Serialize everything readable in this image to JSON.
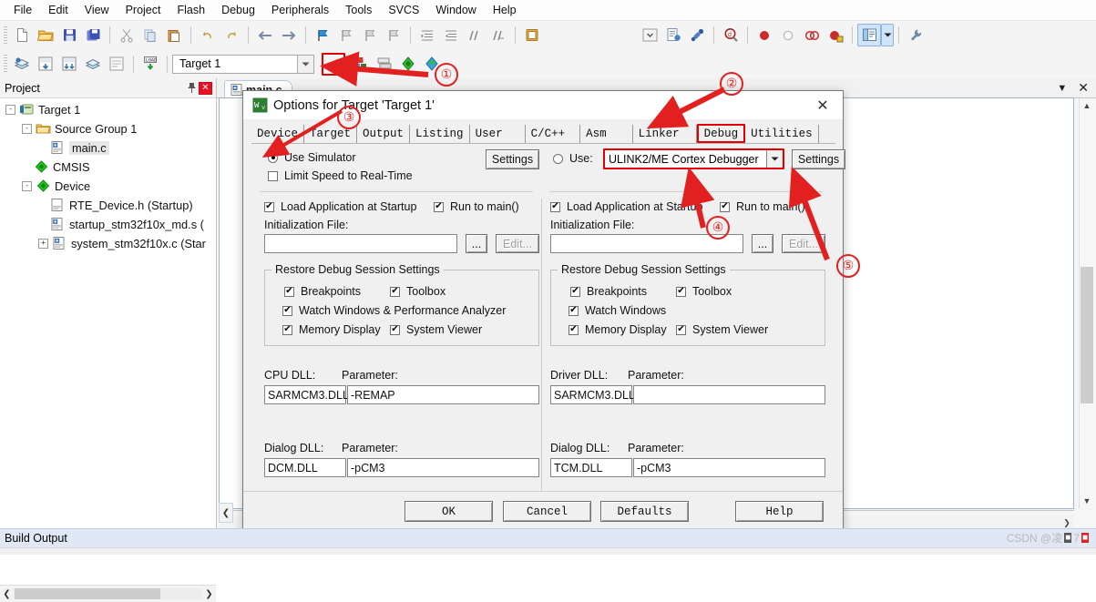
{
  "app": {
    "menu": [
      "File",
      "Edit",
      "View",
      "Project",
      "Flash",
      "Debug",
      "Peripherals",
      "Tools",
      "SVCS",
      "Window",
      "Help"
    ],
    "toolbar1_icons": [
      "new-file-icon",
      "open-folder-icon",
      "save-icon",
      "save-all-icon",
      "cut-icon",
      "copy-icon",
      "paste-icon",
      "undo-icon",
      "redo-icon",
      "navigate-back-icon",
      "navigate-forward-icon",
      "bookmark-toggle-icon",
      "bookmark-prev-icon",
      "bookmark-next-icon",
      "bookmark-clear-icon",
      "indent-icon",
      "outdent-icon",
      "comment-icon",
      "uncomment-icon",
      "open-in-window-icon"
    ],
    "toolbar1_right_icons": [
      "dropdown-icon",
      "configure-icon",
      "debug-settings-icon",
      "find-in-files-icon",
      "insert-breakpoint-icon",
      "disable-breakpoint-icon",
      "kill-all-breakpoints-icon",
      "disable-all-breakpoints-icon",
      "manage-windows-icon",
      "split-dropdown-icon",
      "configure-target-icon"
    ],
    "toolbar2_icons": [
      "translate-icon",
      "build-icon",
      "rebuild-icon",
      "batch-build-icon",
      "stop-build-icon",
      "download-icon"
    ],
    "toolbar2_right_icons": [
      "options-for-target-icon",
      "manage-project-items-icon",
      "multi-project-icon",
      "pack-installer-icon",
      "manage-runtime-env-icon"
    ],
    "target_selector": {
      "value": "Target 1"
    }
  },
  "project_panel": {
    "title": "Project",
    "pin_icon": "pin-icon",
    "close_icon": "close-icon",
    "tree": [
      {
        "label": "Target 1",
        "depth": 0,
        "expander": "-",
        "icon": "project-target-icon"
      },
      {
        "label": "Source Group 1",
        "depth": 1,
        "expander": "-",
        "icon": "folder-icon"
      },
      {
        "label": "main.c",
        "depth": 2,
        "expander": "",
        "icon": "c-file-icon",
        "selected": true
      },
      {
        "label": "CMSIS",
        "depth": 1,
        "expander": "",
        "icon": "component-icon"
      },
      {
        "label": "Device",
        "depth": 1,
        "expander": "-",
        "icon": "component-icon"
      },
      {
        "label": "RTE_Device.h (Startup)",
        "depth": 2,
        "expander": "",
        "icon": "h-file-icon"
      },
      {
        "label": "startup_stm32f10x_md.s (",
        "depth": 2,
        "expander": "",
        "icon": "asm-file-icon"
      },
      {
        "label": "system_stm32f10x.c (Star",
        "depth": 2,
        "expander": "+",
        "icon": "c-file-icon"
      }
    ]
  },
  "editor": {
    "tab_label": "main.c",
    "tab_icon": "c-file-icon",
    "panel_dropdown_icon": "chevron-down-icon",
    "panel_close_icon": "close-icon"
  },
  "dialog": {
    "icon": "keil-uvision-icon",
    "title": "Options for Target 'Target 1'",
    "close_icon": "close-icon",
    "tabs": [
      {
        "label": "Device",
        "selected": false
      },
      {
        "label": "Target",
        "selected": false
      },
      {
        "label": "Output",
        "selected": false
      },
      {
        "label": "Listing",
        "selected": false
      },
      {
        "label": "User",
        "selected": false
      },
      {
        "label": "C/C++",
        "selected": false
      },
      {
        "label": "Asm",
        "selected": false
      },
      {
        "label": "Linker",
        "selected": false
      },
      {
        "label": "Debug",
        "selected": true
      },
      {
        "label": "Utilities",
        "selected": false
      }
    ],
    "left": {
      "use_simulator_label": "Use Simulator",
      "use_simulator_checked": true,
      "limit_speed_label": "Limit Speed to Real-Time",
      "limit_speed_checked": false,
      "settings_label": "Settings",
      "load_app_label": "Load Application at Startup",
      "load_app_checked": true,
      "run_to_main_label": "Run to main()",
      "run_to_main_checked": true,
      "init_file_label": "Initialization File:",
      "init_file_value": "",
      "browse_label": "...",
      "edit_label": "Edit...",
      "restore_group_label": "Restore Debug Session Settings",
      "restore_items": [
        {
          "label": "Breakpoints",
          "checked": true
        },
        {
          "label": "Toolbox",
          "checked": true
        },
        {
          "label": "Watch Windows & Performance Analyzer",
          "checked": true
        },
        {
          "label": "Memory Display",
          "checked": true
        },
        {
          "label": "System Viewer",
          "checked": true
        }
      ],
      "cpu_dll_label": "CPU DLL:",
      "cpu_dll_value": "SARMCM3.DLL",
      "cpu_param_label": "Parameter:",
      "cpu_param_value": "-REMAP",
      "dialog_dll_label": "Dialog DLL:",
      "dialog_dll_value": "DCM.DLL",
      "dialog_param_label": "Parameter:",
      "dialog_param_value": "-pCM3"
    },
    "right": {
      "use_radio_label": "Use:",
      "use_radio_checked": false,
      "debugger_value": "ULINK2/ME Cortex Debugger",
      "debugger_dropdown_icon": "chevron-down-icon",
      "settings_label": "Settings",
      "load_app_label": "Load Application at Startup",
      "load_app_checked": true,
      "run_to_main_label": "Run to main()",
      "run_to_main_checked": true,
      "init_file_label": "Initialization File:",
      "init_file_value": "",
      "browse_label": "...",
      "edit_label": "Edit...",
      "restore_group_label": "Restore Debug Session Settings",
      "restore_items": [
        {
          "label": "Breakpoints",
          "checked": true
        },
        {
          "label": "Toolbox",
          "checked": true
        },
        {
          "label": "Watch Windows",
          "checked": true
        },
        {
          "label": "Memory Display",
          "checked": true
        },
        {
          "label": "System Viewer",
          "checked": true
        }
      ],
      "driver_dll_label": "Driver DLL:",
      "driver_dll_value": "SARMCM3.DLL",
      "driver_param_label": "Parameter:",
      "driver_param_value": "",
      "dialog_dll_label": "Dialog DLL:",
      "dialog_dll_value": "TCM.DLL",
      "dialog_param_label": "Parameter:",
      "dialog_param_value": "-pCM3"
    },
    "footer": {
      "ok": "OK",
      "cancel": "Cancel",
      "defaults": "Defaults",
      "help": "Help"
    }
  },
  "status": {
    "build_output_label": "Build Output",
    "watermark_prefix": "CSDN @凌",
    "watermark_tail": "7"
  },
  "annotations": {
    "markers": [
      "①",
      "②",
      "③",
      "④",
      "⑤"
    ],
    "color": "#e32020"
  }
}
